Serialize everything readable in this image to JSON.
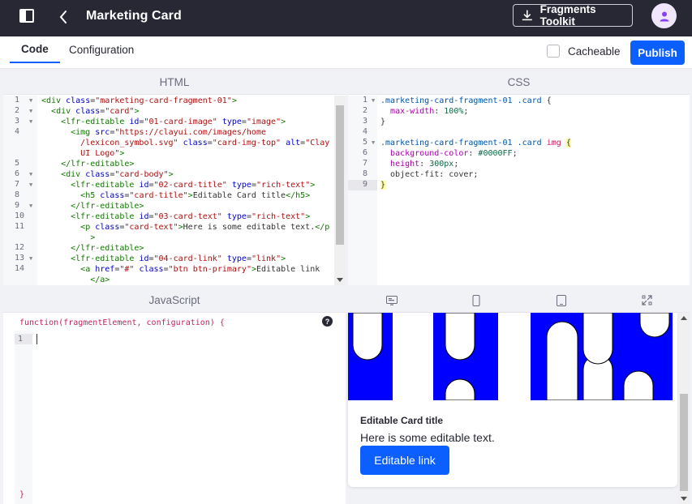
{
  "header": {
    "title": "Marketing Card",
    "toolkit_label": "Fragments Toolkit"
  },
  "tabs": [
    {
      "label": "Code",
      "active": true
    },
    {
      "label": "Configuration",
      "active": false
    }
  ],
  "toolbar": {
    "cacheable_label": "Cacheable",
    "publish_label": "Publish"
  },
  "editors": {
    "html": {
      "title": "HTML",
      "line_numbers": [
        "1",
        "2",
        "3",
        "4",
        "",
        "",
        "5",
        "6",
        "7",
        "8",
        "9",
        "10",
        "11",
        "",
        "12",
        "13",
        "14"
      ]
    },
    "css": {
      "title": "CSS",
      "line_numbers": [
        "1",
        "2",
        "3",
        "4",
        "5",
        "6",
        "7",
        "8",
        "9"
      ]
    },
    "js": {
      "title": "JavaScript",
      "signature": "function(fragmentElement, configuration) {",
      "closing": "}",
      "line_numbers": [
        "1"
      ]
    }
  },
  "preview": {
    "card_title": "Editable Card title",
    "card_text": "Here is some editable text.",
    "card_link": "Editable link",
    "image_color": "#0000FF"
  },
  "colors": {
    "accent": "#0b5fff",
    "topbar": "#272833"
  }
}
